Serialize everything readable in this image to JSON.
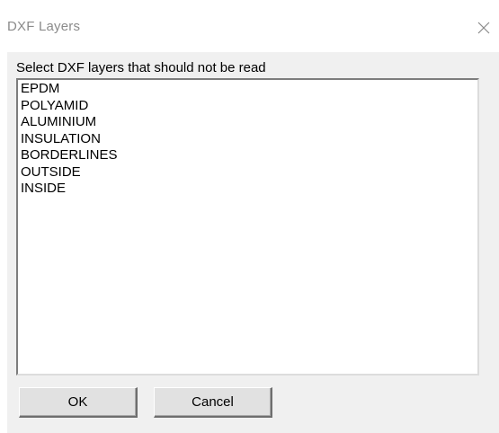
{
  "window": {
    "title": "DXF Layers",
    "close_icon": "close-icon"
  },
  "dialog": {
    "prompt": "Select DXF layers that should not be read",
    "layers": [
      "EPDM",
      "POLYAMID",
      "ALUMINIUM",
      "INSULATION",
      "BORDERLINES",
      "OUTSIDE",
      "INSIDE"
    ]
  },
  "buttons": {
    "ok_label": "OK",
    "cancel_label": "Cancel"
  },
  "colors": {
    "title_text": "#8b8b8b",
    "client_background": "#f0f0f0",
    "list_background": "#ffffff",
    "button_face": "#e1e1e1"
  }
}
